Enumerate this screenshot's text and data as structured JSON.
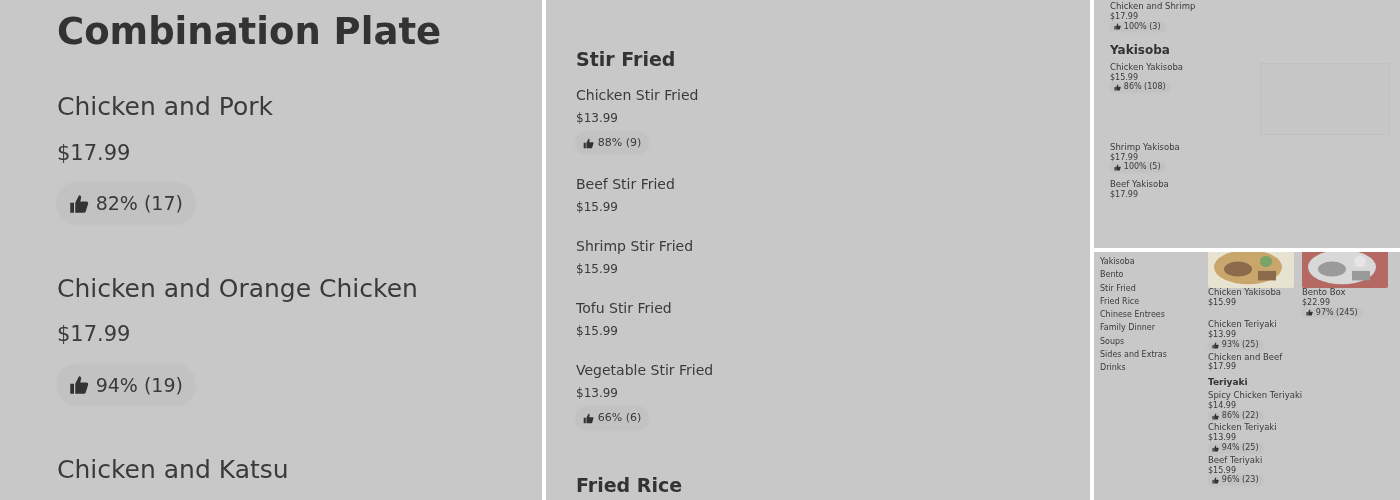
{
  "panels": [
    {
      "kind": "menu",
      "sections": [
        {
          "title": "Combination Plate",
          "items": [
            {
              "name": "Chicken and Pork",
              "price": "$17.99",
              "rating": "82% (17)"
            },
            {
              "name": "Chicken and Orange Chicken",
              "price": "$17.99",
              "rating": "94% (19)"
            },
            {
              "name": "Chicken and Katsu"
            }
          ]
        }
      ]
    },
    {
      "kind": "menu",
      "sections": [
        {
          "title": "Stir Fried",
          "items": [
            {
              "name": "Chicken Stir Fried",
              "price": "$13.99",
              "rating": "88% (9)"
            },
            {
              "name": "Beef Stir Fried",
              "price": "$15.99"
            },
            {
              "name": "Shrimp Stir Fried",
              "price": "$15.99"
            },
            {
              "name": "Tofu Stir Fried",
              "price": "$15.99"
            },
            {
              "name": "Vegetable Stir Fried",
              "price": "$13.99",
              "rating": "66% (6)"
            }
          ]
        },
        {
          "title": "Fried Rice"
        }
      ]
    },
    {
      "kind": "menu",
      "sections": [
        {
          "items": [
            {
              "name": "Chicken and Shrimp",
              "price": "$17.99",
              "rating": "100% (3)"
            }
          ]
        },
        {
          "title": "Yakisoba",
          "items": [
            {
              "name": "Chicken Yakisoba",
              "price": "$15.99",
              "rating": "86% (108)",
              "thumbnail": true
            },
            {
              "name": "Shrimp Yakisoba",
              "price": "$17.99",
              "rating": "100% (5)"
            },
            {
              "name": "Beef Yakisoba",
              "price": "$17.99"
            }
          ]
        }
      ]
    },
    {
      "kind": "store",
      "categories": [
        "Yakisoba",
        "Bento",
        "Stir Fried",
        "Fried Rice",
        "Chinese Entrees",
        "Family Dinner",
        "Soups",
        "Sides and Extras",
        "Drinks"
      ],
      "featured": [
        {
          "name": "Chicken Yakisoba",
          "price": "$15.99",
          "picture": true
        },
        {
          "name": "Bento Box",
          "price": "$22.99",
          "rating": "97% (245)",
          "picture": true
        },
        {
          "name": "Chicken Teriyaki",
          "price": "$13.99",
          "rating": "93% (25)"
        },
        {
          "name": "Chicken and Beef",
          "price": "$17.99"
        }
      ],
      "sections": [
        {
          "title": "Teriyaki",
          "items": [
            {
              "name": "Spicy Chicken Teriyaki",
              "price": "$14.99",
              "rating": "86% (22)"
            },
            {
              "name": "Chicken Teriyaki",
              "price": "$13.99",
              "rating": "94% (25)"
            },
            {
              "name": "Beef Teriyaki",
              "price": "$15.99",
              "rating": "96% (23)"
            }
          ]
        }
      ]
    }
  ]
}
